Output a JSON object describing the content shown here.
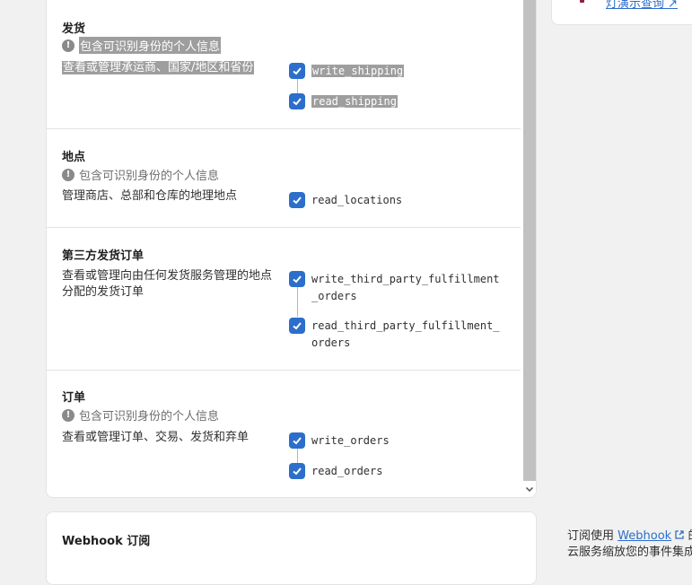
{
  "sections": [
    {
      "title": "发货",
      "pii": "包含可识别身份的个人信息",
      "description": "查看或管理承运商、国家/地区和省份",
      "scopes": [
        "write_shipping",
        "read_shipping"
      ]
    },
    {
      "title": "地点",
      "pii": "包含可识别身份的个人信息",
      "description": "管理商店、总部和仓库的地理地点",
      "scopes": [
        "read_locations"
      ]
    },
    {
      "title": "第三方发货订单",
      "description": "查看或管理向由任何发货服务管理的地点分配的发货订单",
      "scopes": [
        "write_third_party_fulfillment_orders",
        "read_third_party_fulfillment_orders"
      ]
    },
    {
      "title": "订单",
      "pii": "包含可识别身份的个人信息",
      "description": "查看或管理订单、交易、发货和弃单",
      "scopes": [
        "write_orders",
        "read_orders"
      ]
    }
  ],
  "side": {
    "link": "灯演示查询"
  },
  "webhook": {
    "title": "Webhook 订阅"
  },
  "right_panel": {
    "prefix": "订阅使用",
    "link": "Webhook",
    "suffix": "的",
    "line2": "云服务缩放您的事件集成"
  },
  "icons": {
    "alert": "alert-circle-icon",
    "check": "checkmark-icon",
    "external": "external-link-icon"
  },
  "colors": {
    "accent": "#2c6ecb"
  }
}
